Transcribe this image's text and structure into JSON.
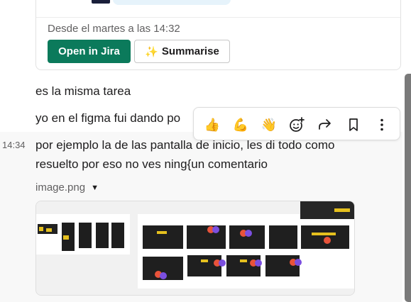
{
  "jira_card": {
    "since": "Desde el martes a las 14:32",
    "open_button": "Open in Jira",
    "summarise_button": "Summarise",
    "summarise_icon": "sparkles-icon"
  },
  "messages": {
    "line1": "es la misma tarea",
    "line2": "yo en el figma fui dando po",
    "hover": {
      "time": "14:34",
      "line1": "por ejemplo la de las pantalla de inicio, les di todo como",
      "line2": "resuelto por eso no ves ning{un comentario"
    }
  },
  "attachment": {
    "file_name": "image.png",
    "expand_icon": "caret-down-icon"
  },
  "toolbar": {
    "icons": [
      "thumbs-up-emoji",
      "flexed-biceps-emoji",
      "waving-hand-emoji",
      "add-reaction-icon",
      "forward-icon",
      "bookmark-icon",
      "more-actions-icon"
    ]
  },
  "colors": {
    "primary_button": "#0b7a5b",
    "text": "#1d1c1d",
    "muted": "#616061",
    "hover_bg": "#f8f8f8"
  }
}
